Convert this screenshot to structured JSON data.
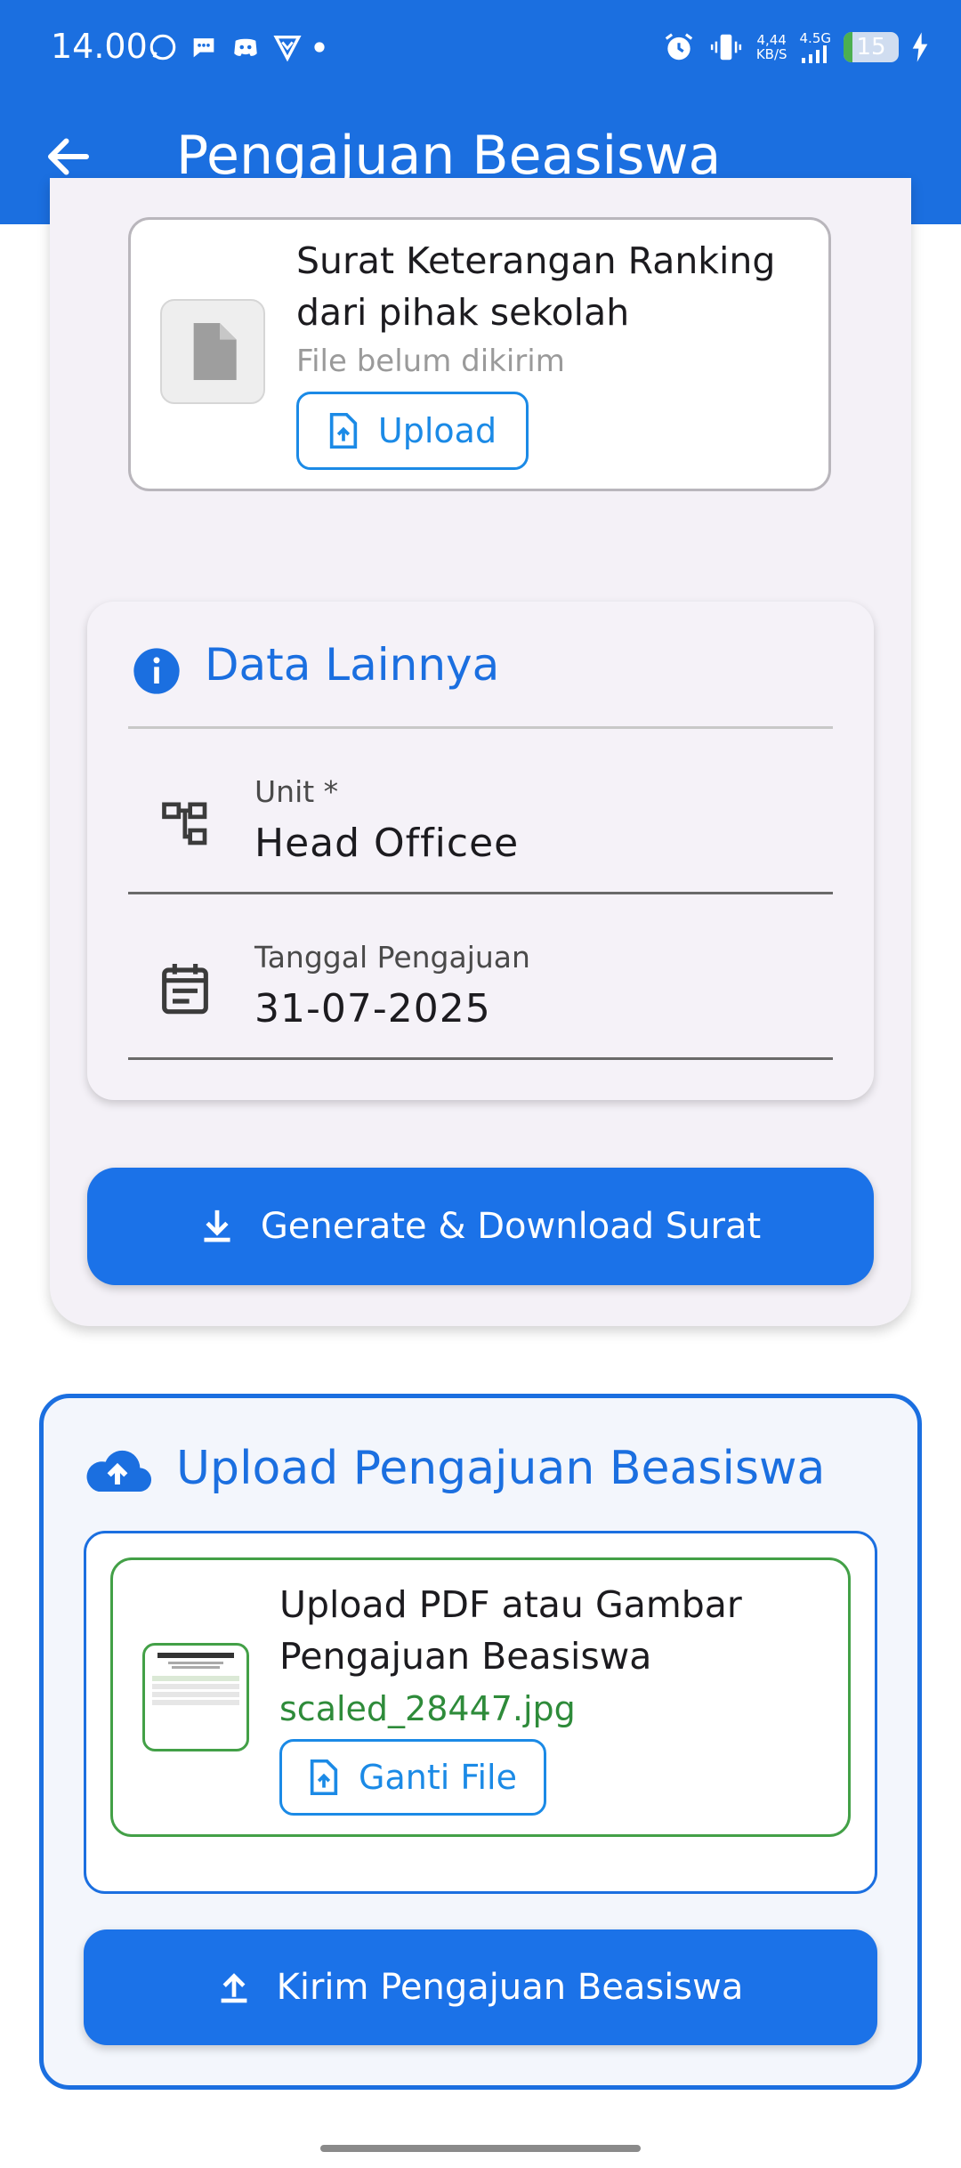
{
  "status_bar": {
    "time": "14.00",
    "net_speed_top": "4,44",
    "net_speed_bottom": "KB/S",
    "network_type": "4.5G",
    "battery": "15"
  },
  "app_bar": {
    "title": "Pengajuan Beasiswa"
  },
  "ranking_file": {
    "title": "Surat Keterangan Ranking dari pihak sekolah",
    "status": "File belum dikirim",
    "upload_label": "Upload"
  },
  "other_data": {
    "title": "Data Lainnya",
    "unit_label": "Unit *",
    "unit_value": "Head Officee",
    "date_label": "Tanggal Pengajuan",
    "date_value": "31-07-2025"
  },
  "generate_button": {
    "label": "Generate & Download Surat"
  },
  "upload_section": {
    "title": "Upload Pengajuan Beasiswa",
    "file_title": "Upload PDF atau Gambar Pengajuan Beasiswa",
    "filename": "scaled_28447.jpg",
    "change_label": "Ganti File",
    "submit_label": "Kirim Pengajuan Beasiswa"
  },
  "colors": {
    "primary": "#1b6fe0",
    "button": "#1b72e8",
    "success": "#43a047",
    "outline_accent": "#1b8ae6"
  }
}
